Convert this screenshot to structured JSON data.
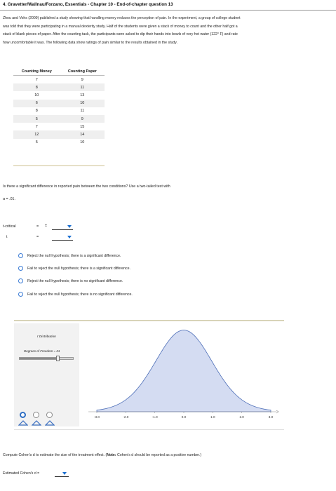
{
  "header": {
    "title": "4. Gravetter/Wallnau/Forzano, Essentials - Chapter 10 - End-of-chapter question 13"
  },
  "intro": {
    "line1": "Zhou and Vohs (2009) published a study showing that handling money reduces the perception of pain. In the experiment, a group of college student",
    "line2": "was told that they were participating in a manual dexterity study. Half of the students were given a stack of money to count and the other half got a",
    "line3": "stack of blank pieces of paper. After the counting task, the participants were asked to dip their hands into bowls of very hot water (122° F) and rate",
    "line4": "how uncomfortable it was. The following data show ratings of pain similar to the results obtained in the study."
  },
  "table": {
    "headers": [
      "Counting Money",
      "Counting Paper"
    ],
    "rows": [
      [
        "7",
        "9"
      ],
      [
        "8",
        "11"
      ],
      [
        "10",
        "13"
      ],
      [
        "6",
        "10"
      ],
      [
        "8",
        "11"
      ],
      [
        "5",
        "9"
      ],
      [
        "7",
        "15"
      ],
      [
        "12",
        "14"
      ],
      [
        "5",
        "10"
      ]
    ]
  },
  "question": {
    "text": "Is there a significant difference in reported pain between the two conditions? Use a two-tailed test with",
    "alpha": "α = .01."
  },
  "answers": {
    "tcritical_label": "t-critical",
    "equals": "=",
    "plusminus": "±",
    "t_label": "t",
    "t_equals": "="
  },
  "options": [
    "Reject the null hypothesis; there is a significant difference.",
    "Fail to reject the null hypothesis; there is a significant difference.",
    "Reject the null hypothesis; there is no significant difference.",
    "Fail to reject the null hypothesis; there is no significant difference."
  ],
  "widget": {
    "title": "t Distribution",
    "df_label": "Degrees of Freedom = 21",
    "selected_radio": 0,
    "colors": {
      "curve_fill": "#d4dcf2",
      "curve_stroke": "#4e6fb8",
      "radio_selected": "#2f6fc4"
    }
  },
  "chart_data": {
    "type": "area",
    "title": "",
    "xlabel": "",
    "ylabel": "",
    "df": 21,
    "xlim": [
      -3.0,
      3.0
    ],
    "x_ticks": [
      "-3.0",
      "-2.0",
      "-1.0",
      "0.0",
      "1.0",
      "2.0",
      "3.0"
    ],
    "x": [
      -3.0,
      -2.5,
      -2.0,
      -1.5,
      -1.0,
      -0.5,
      0.0,
      0.5,
      1.0,
      1.5,
      2.0,
      2.5,
      3.0
    ],
    "y": [
      0.007,
      0.022,
      0.057,
      0.128,
      0.236,
      0.349,
      0.396,
      0.349,
      0.236,
      0.128,
      0.057,
      0.022,
      0.007
    ],
    "grid": false
  },
  "cohen": {
    "question_prefix": "Compute Cohen's d to estimate the size of the treatment effect. (",
    "note_label": "Note:",
    "question_suffix": " Cohen's d should be reported as a positive number.)",
    "label": "Estimated Cohen's d ="
  }
}
